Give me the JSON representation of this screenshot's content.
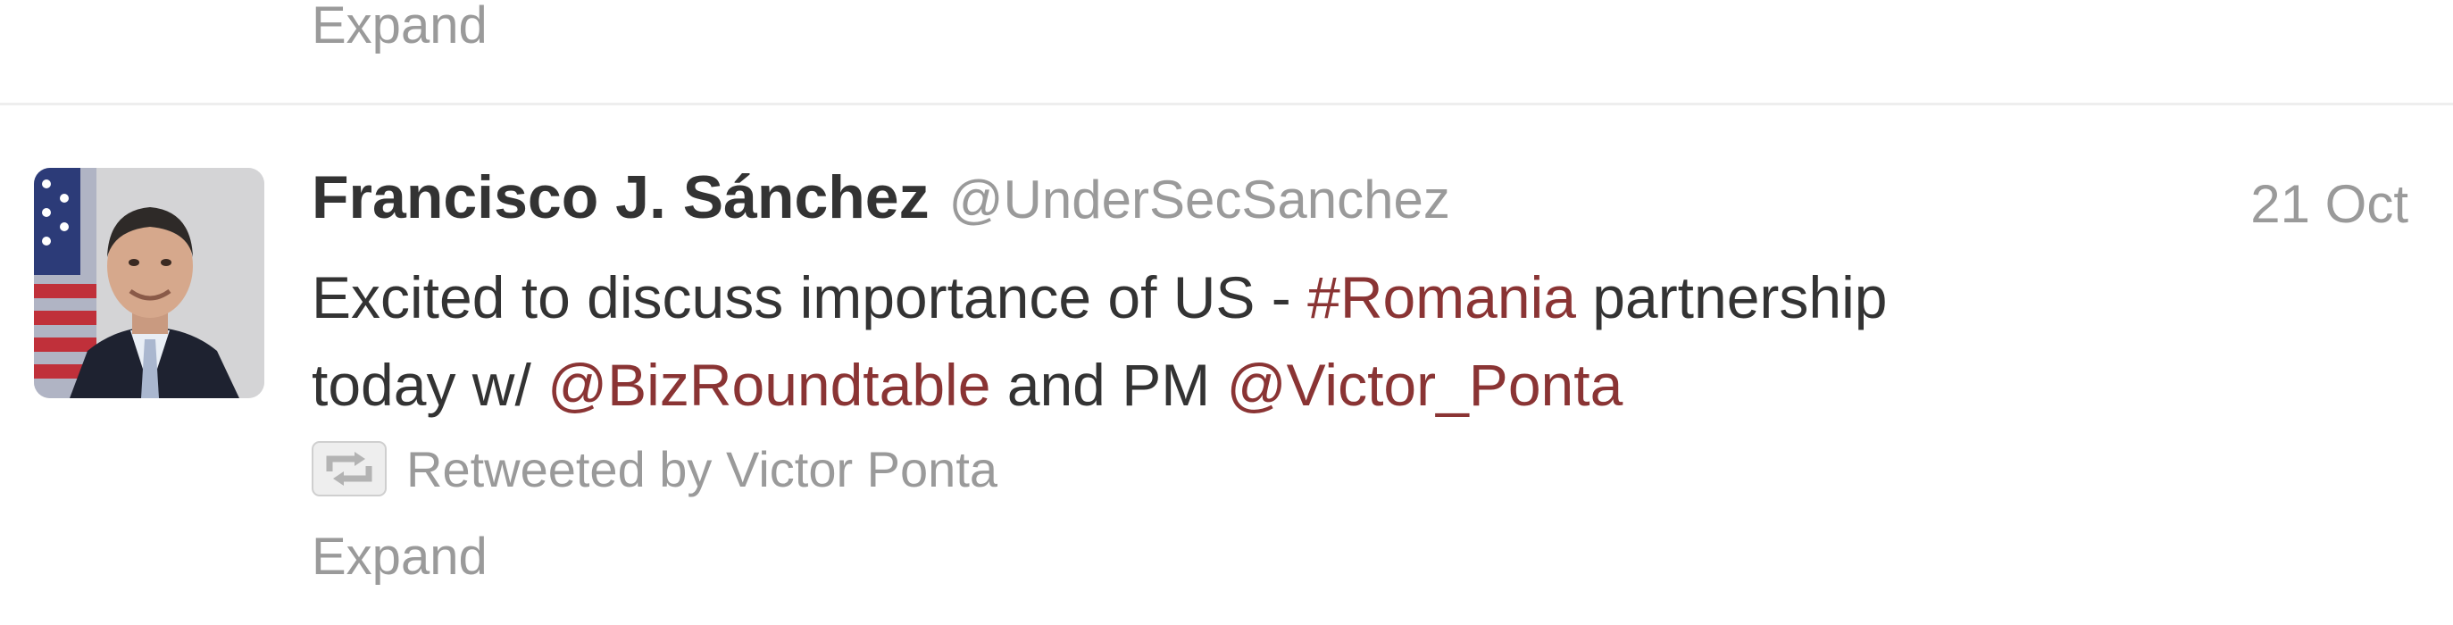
{
  "previous_tweet": {
    "expand_label": "Expand"
  },
  "tweet": {
    "avatar_icon": "profile-photo",
    "fullname": "Francisco J. Sánchez",
    "username": "@UnderSecSanchez",
    "timestamp": "21 Oct",
    "text": {
      "line1_prefix": "Excited to discuss importance of US - ",
      "hashtag": "#Romania",
      "line1_suffix": " partnership",
      "line2_prefix": "today w/ ",
      "mention1": "@BizRoundtable",
      "line2_middle": " and PM ",
      "mention2": "@Victor_Ponta"
    },
    "retweet_icon": "retweet-icon",
    "retweeted_by": "Retweeted by Victor Ponta",
    "expand_label": "Expand"
  },
  "colors": {
    "link": "#8a3434",
    "muted": "#9a9a9a",
    "text": "#333333"
  }
}
